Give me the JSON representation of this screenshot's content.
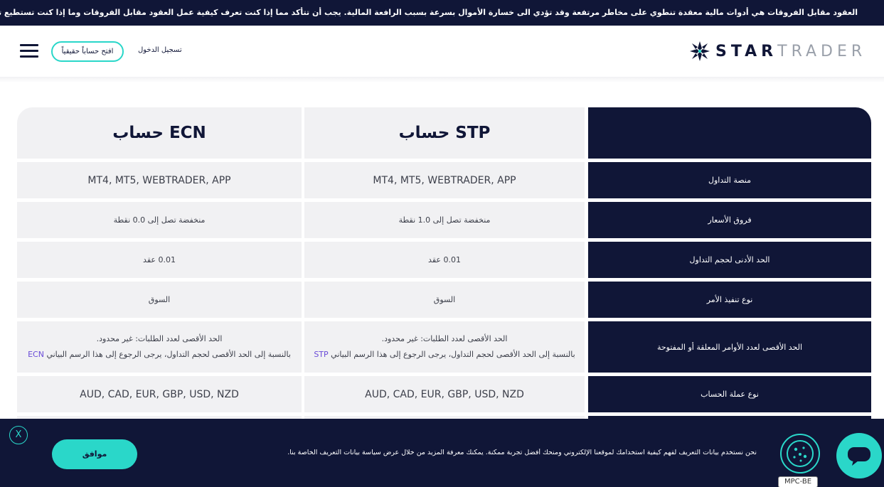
{
  "risk_banner": {
    "text": "العقود مقابل الفروقات هي أدوات مالية معقدة تنطوي على مخاطر مرتفعة وقد تؤدي الى خسارة الأموال بسرعة بسبب الرافعة المالية. يجب أن تتأكد مما إذا كنت تعرف كيفية عمل العقود مقابل الفروقات وما إذا كنت تستطيع تحمل المخاطر المترتبة عليها كالتي قد تتسبب بخسارة رأس مالك."
  },
  "header": {
    "logo_star": "STAR",
    "logo_trader": "TRADER",
    "login_label": "تسجيل الدخول",
    "open_account_label": "افتح حساباً حقيقياً",
    "menu_icon": "hamburger-menu-icon"
  },
  "table": {
    "columns": {
      "ecn": "حساب ECN",
      "stp": "حساب STP"
    },
    "rows": [
      {
        "label": "منصة التداول",
        "stp": "MT4, MT5, WEBTRADER, APP",
        "ecn": "MT4, MT5, WEBTRADER, APP"
      },
      {
        "label": "فروق الأسعار",
        "stp": "منخفضة تصل إلى 1.0 نقطة",
        "ecn": "منخفضة تصل إلى 0.0 نقطة"
      },
      {
        "label": "الحد الأدنى لحجم التداول",
        "stp": "0.01 عقد",
        "ecn": "0.01 عقد"
      },
      {
        "label": "نوع تنفيذ الأمر",
        "stp": "السوق",
        "ecn": "السوق"
      },
      {
        "label": "الحد الأقصى لعدد الأوامر المعلقة أو المفتوحة",
        "stp_line1": "الحد الأقصى لعدد الطلبات: غير محدود.",
        "stp_line2": "بالنسبة إلى الحد الأقصى لحجم التداول، يرجى الرجوع إلى هذا الرسم البياني",
        "stp_link": "STP",
        "ecn_line1": "الحد الأقصى لعدد الطلبات: غير محدود.",
        "ecn_line2": "بالنسبة إلى الحد الأقصى لحجم التداول، يرجى الرجوع إلى هذا الرسم البياني",
        "ecn_link": "ECN"
      },
      {
        "label": "نوع عملة الحساب",
        "stp": "AUD, CAD, EUR, GBP, USD, NZD",
        "ecn": "AUD, CAD, EUR, GBP, USD, NZD"
      }
    ]
  },
  "cookie": {
    "close_label": "X",
    "accept_label": "موافق",
    "text": "نحن نستخدم بيانات التعريف لفهم كيفية استخدامك لموقعنا الإلكتروني ومنحك أفضل تجربة ممكنة. يمكنك معرفة المزيد من خلال عرض سياسة بيانات التعريف الخاصة بنا.",
    "badge": "MPC-BE",
    "cookie_icon": "cookie-icon",
    "chat_icon": "chat-icon"
  },
  "colors": {
    "navy": "#101637",
    "accent": "#2ad7c9",
    "cell_bg": "#f1f1f3",
    "link": "#6a4bd8"
  }
}
